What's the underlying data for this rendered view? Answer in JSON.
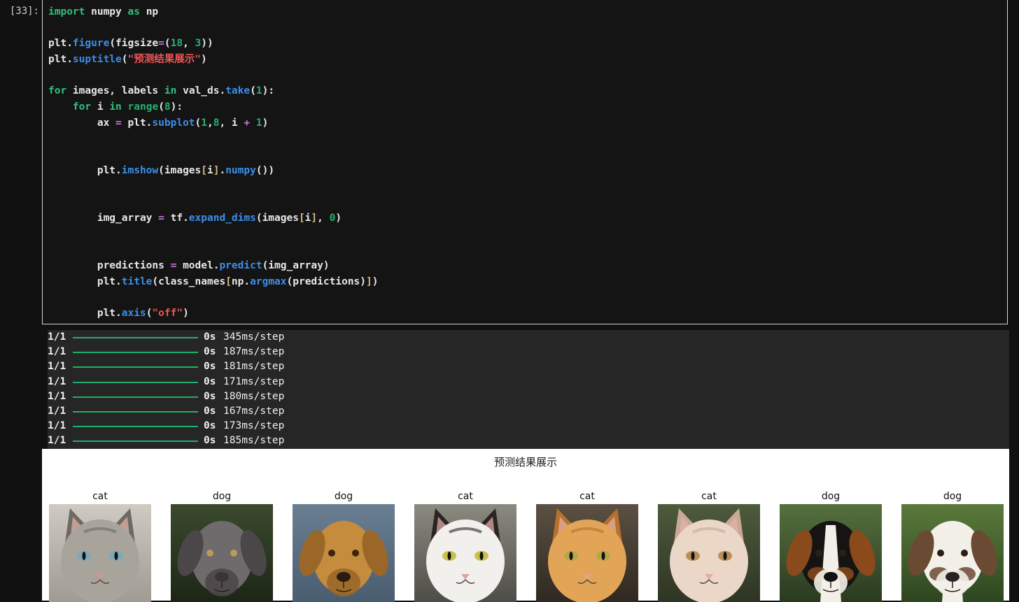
{
  "cell": {
    "prompt": "[33]:",
    "code_lines": [
      "import numpy as np",
      "",
      "plt.figure(figsize=(18, 3))",
      "plt.suptitle(\"预测结果展示\")",
      "",
      "for images, labels in val_ds.take(1):",
      "    for i in range(8):",
      "        ax = plt.subplot(1,8, i + 1)",
      "",
      "",
      "        plt.imshow(images[i].numpy())",
      "",
      "",
      "        img_array = tf.expand_dims(images[i], 0)",
      "",
      "",
      "        predictions = model.predict(img_array)",
      "        plt.title(class_names[np.argmax(predictions)])",
      "",
      "        plt.axis(\"off\")"
    ]
  },
  "output": {
    "progress_lines": [
      {
        "fraction": "1/1",
        "progress": 1.0,
        "seconds": "0s",
        "step": "345ms/step"
      },
      {
        "fraction": "1/1",
        "progress": 1.0,
        "seconds": "0s",
        "step": "187ms/step"
      },
      {
        "fraction": "1/1",
        "progress": 1.0,
        "seconds": "0s",
        "step": "181ms/step"
      },
      {
        "fraction": "1/1",
        "progress": 1.0,
        "seconds": "0s",
        "step": "171ms/step"
      },
      {
        "fraction": "1/1",
        "progress": 1.0,
        "seconds": "0s",
        "step": "180ms/step"
      },
      {
        "fraction": "1/1",
        "progress": 1.0,
        "seconds": "0s",
        "step": "167ms/step"
      },
      {
        "fraction": "1/1",
        "progress": 1.0,
        "seconds": "0s",
        "step": "173ms/step"
      },
      {
        "fraction": "1/1",
        "progress": 1.0,
        "seconds": "0s",
        "step": "185ms/step"
      }
    ],
    "progress_color": "#1bb36a"
  },
  "figure": {
    "suptitle": "预测结果展示",
    "subplots": [
      {
        "title": "cat",
        "image": "tabby-cat-photo"
      },
      {
        "title": "dog",
        "image": "grey-weimaraner-dog-photo"
      },
      {
        "title": "dog",
        "image": "golden-labrador-dog-photo"
      },
      {
        "title": "cat",
        "image": "black-white-cat-photo"
      },
      {
        "title": "cat",
        "image": "orange-tabby-cat-photo"
      },
      {
        "title": "cat",
        "image": "cream-cat-photo"
      },
      {
        "title": "dog",
        "image": "bernese-mountain-dog-photo"
      },
      {
        "title": "dog",
        "image": "bulldog-photo"
      }
    ]
  },
  "colors": {
    "background": "#111111",
    "editor_border": "#d6d6d6",
    "keyword": "#2ec27e",
    "function": "#3b8eea",
    "string": "#f05454",
    "operator": "#c678dd"
  }
}
